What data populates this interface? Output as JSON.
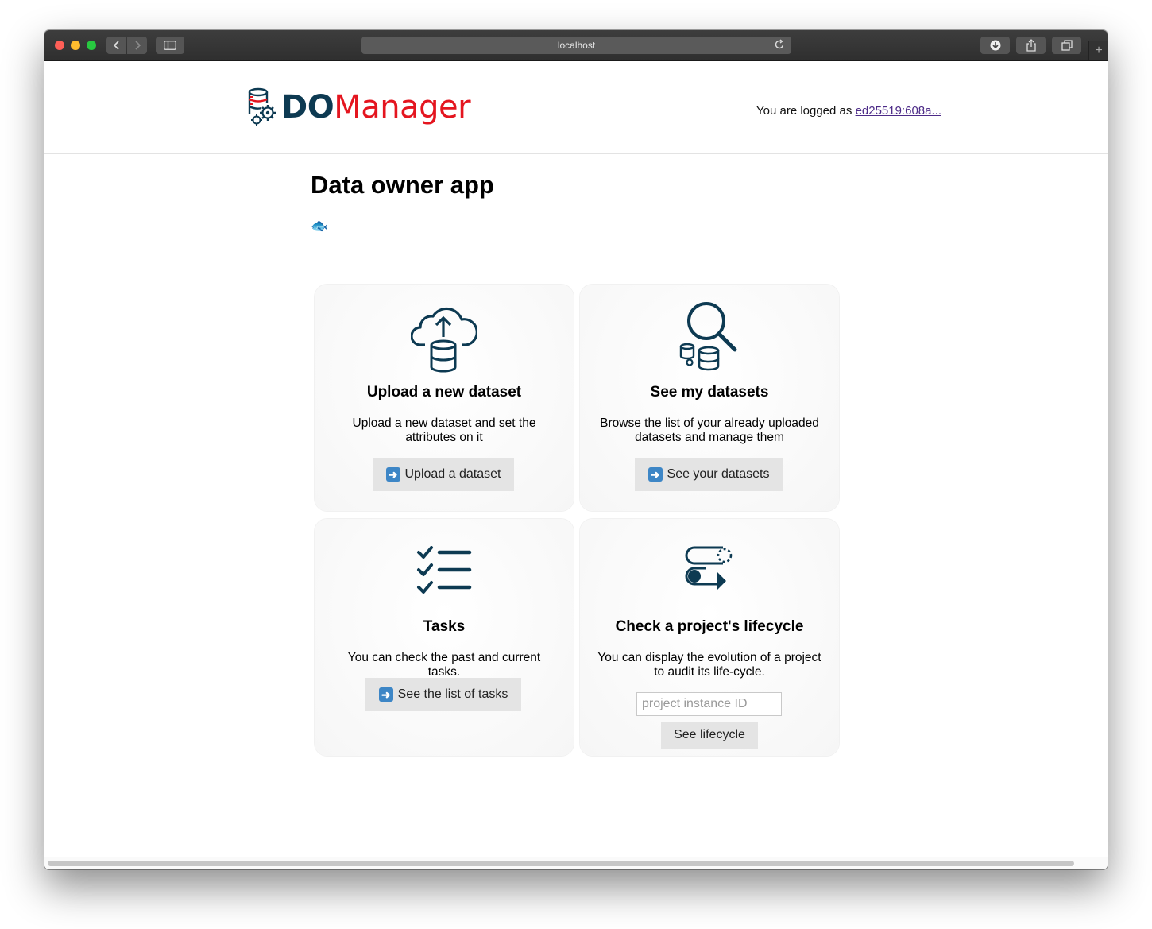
{
  "browser": {
    "url": "localhost"
  },
  "header": {
    "logo_part1": "DO",
    "logo_part2": "Manager",
    "logged_prefix": "You are logged as",
    "logged_user": "ed25519:608a..."
  },
  "main": {
    "title": "Data owner app",
    "emoji": "🐟"
  },
  "cards": [
    {
      "icon": "cloud-upload-database-icon",
      "title": "Upload a new dataset",
      "description": "Upload a new dataset and set the attributes on it",
      "button": "Upload a dataset"
    },
    {
      "icon": "search-datasets-icon",
      "title": "See my datasets",
      "description": "Browse the list of your already uploaded datasets and manage them",
      "button": "See your datasets"
    },
    {
      "icon": "checklist-icon",
      "title": "Tasks",
      "description": "You can check the past and current tasks.",
      "button": "See the list of tasks"
    },
    {
      "icon": "lifecycle-icon",
      "title": "Check a project's lifecycle",
      "description": "You can display the evolution of a project to audit its life-cycle.",
      "input_placeholder": "project instance ID",
      "button": "See lifecycle"
    }
  ],
  "colors": {
    "brand_dark": "#0d3a52",
    "brand_red": "#e4151f",
    "button_bg": "#e4e4e4",
    "arrow_blue": "#3d86c6"
  }
}
